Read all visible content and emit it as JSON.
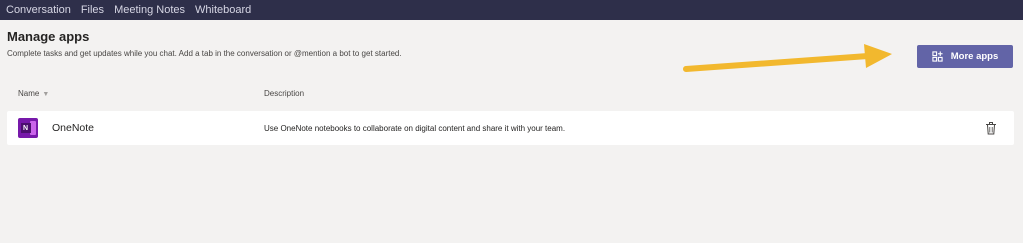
{
  "tabs": [
    "Conversation",
    "Files",
    "Meeting Notes",
    "Whiteboard"
  ],
  "header": {
    "title": "Manage apps",
    "subtitle": "Complete tasks and get updates while you chat. Add a tab in the conversation or @mention a bot to get started."
  },
  "more_apps_label": "More apps",
  "columns": {
    "name": "Name",
    "description": "Description"
  },
  "apps": [
    {
      "name": "OneNote",
      "icon_letter": "N",
      "description": "Use OneNote notebooks to collaborate on digital content and share it with your team."
    }
  ],
  "colors": {
    "tab_bar": "#2e2f4a",
    "accent": "#6264a7",
    "arrow": "#f2b82e",
    "onenote": "#7719aa"
  },
  "icons": {
    "more_apps": "apps-grid-icon",
    "sort": "sort-caret-icon",
    "delete": "trash-icon"
  }
}
